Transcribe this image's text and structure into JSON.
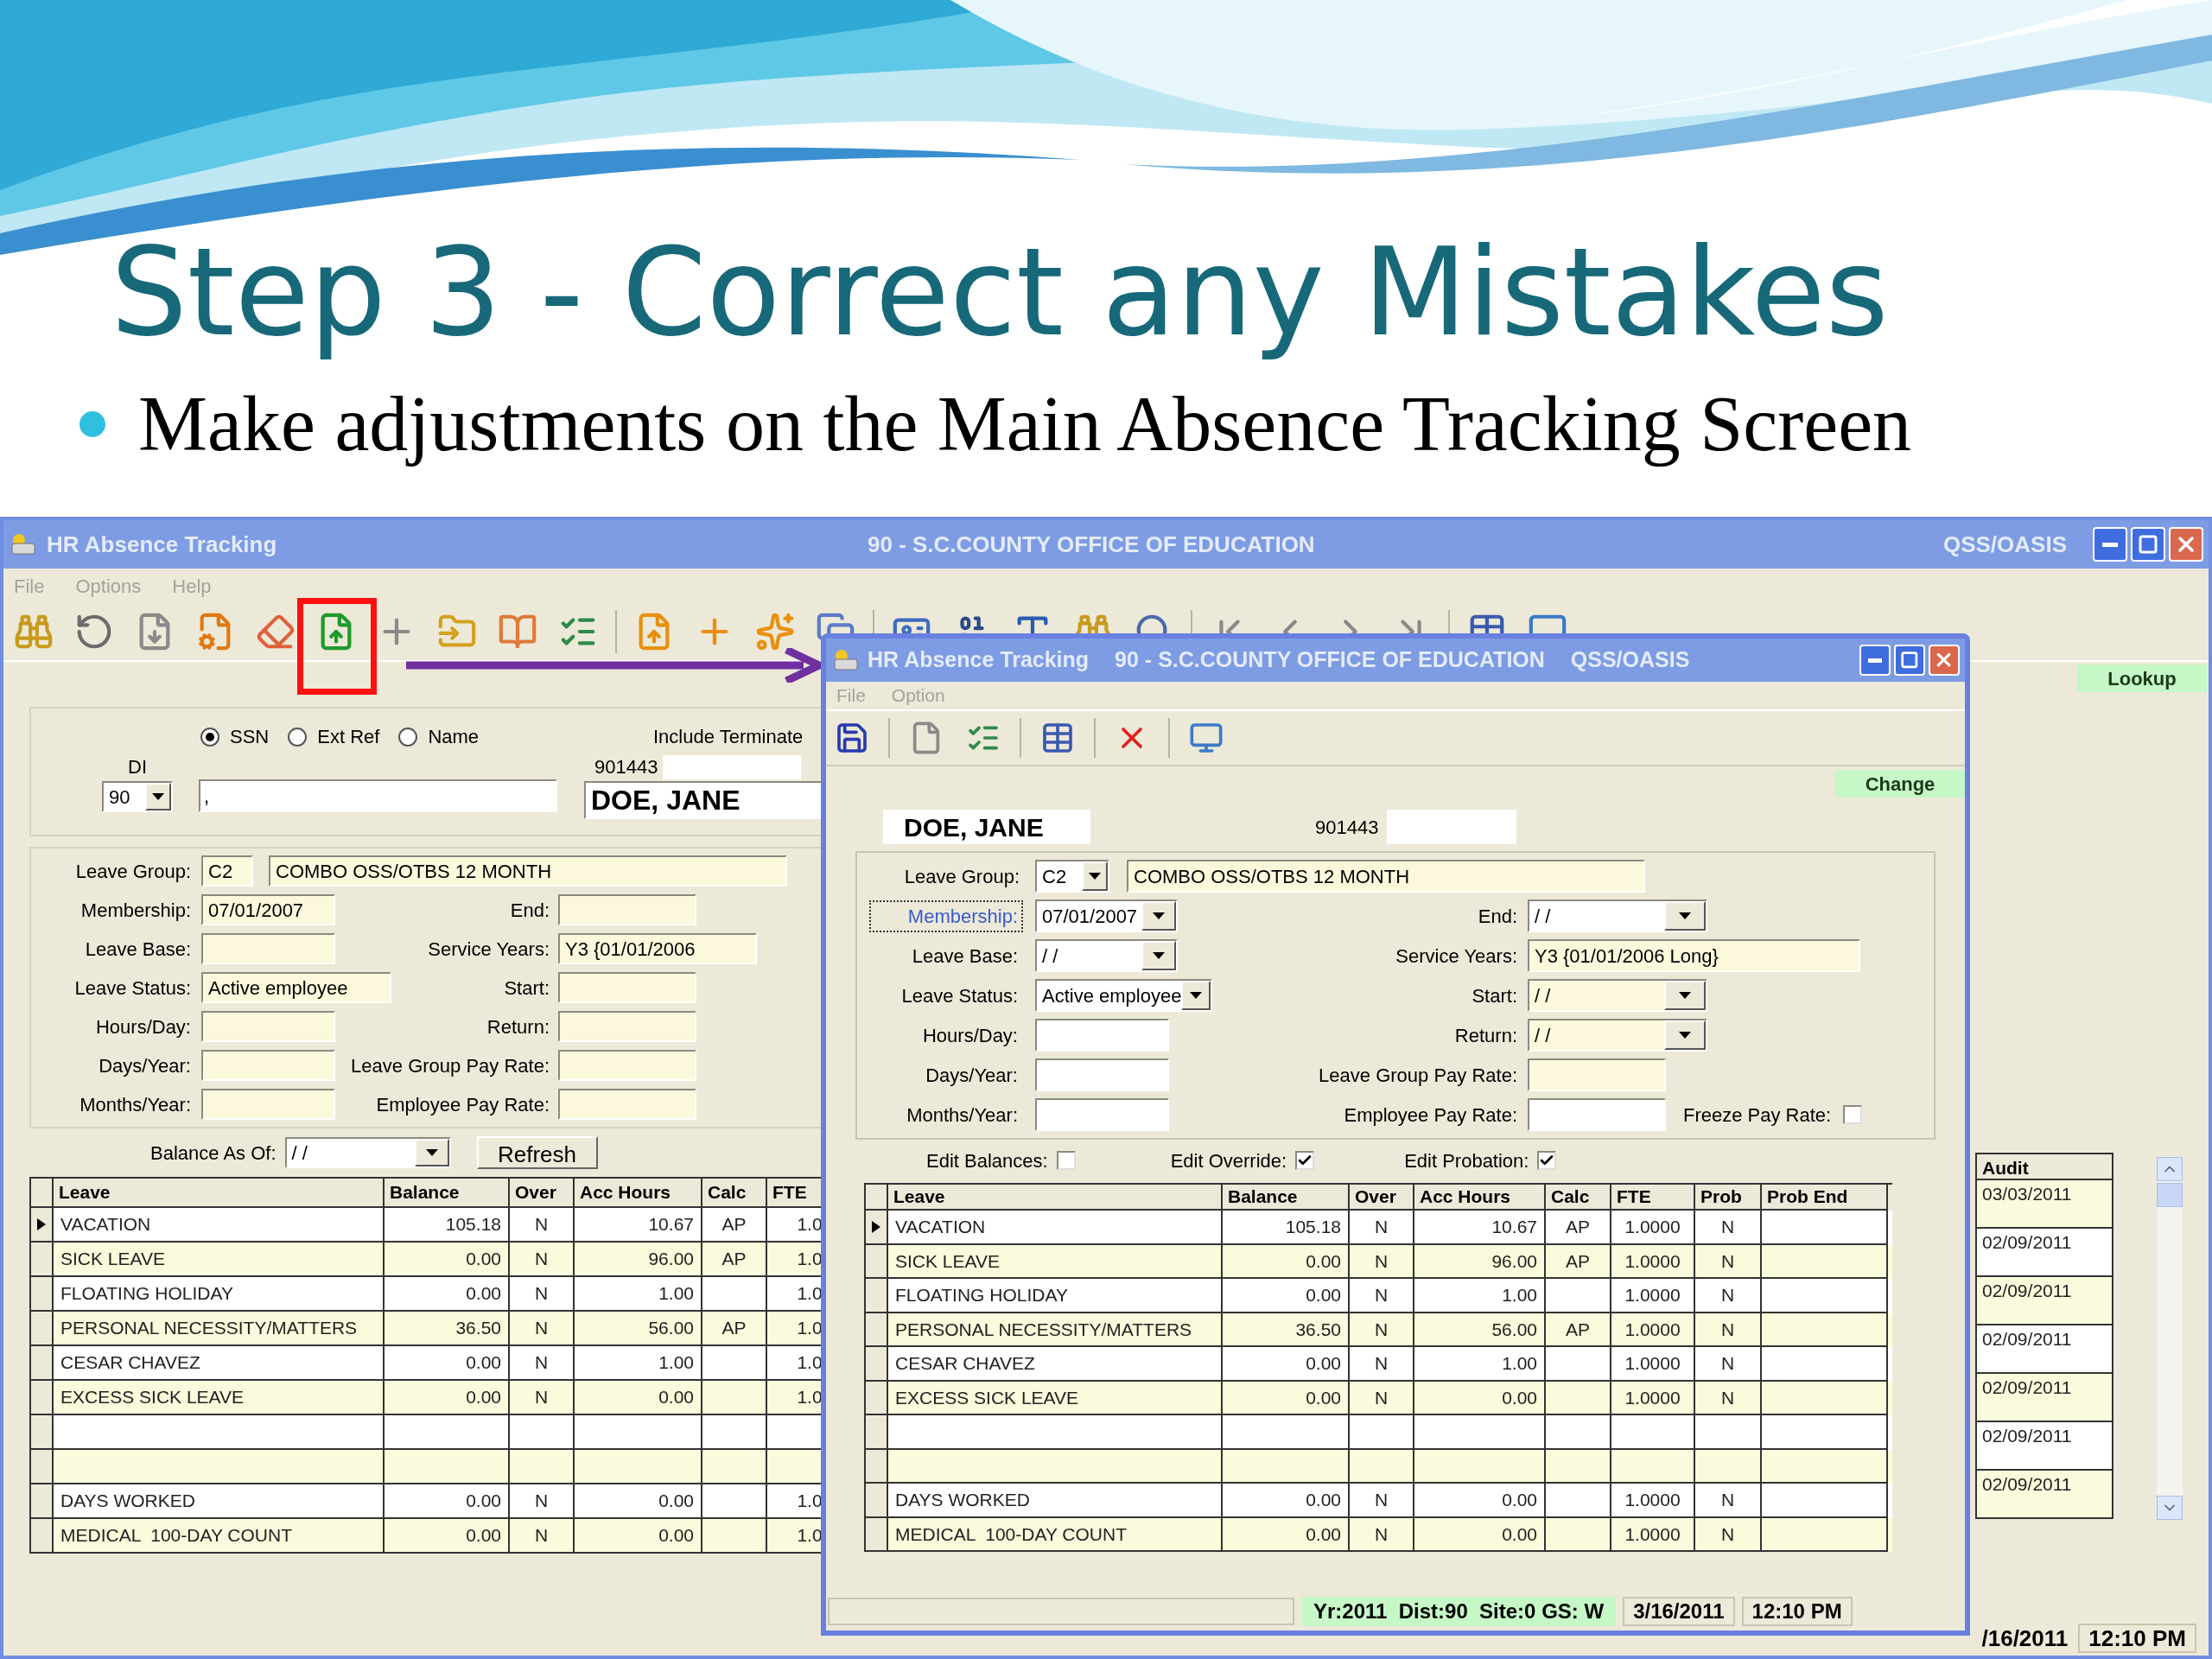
{
  "slide": {
    "title": "Step 3 - Correct any Mistakes",
    "bullet": "Make adjustments on the Main Absence Tracking Screen"
  },
  "main_window": {
    "title": "HR Absence Tracking",
    "district": "90 - S.C.COUNTY OFFICE OF EDUCATION",
    "product": "QSS/OASIS",
    "menu": [
      "File",
      "Options",
      "Help"
    ],
    "toolbar": [
      {
        "kind": "binoculars",
        "highlighted": false
      },
      {
        "kind": "undo",
        "highlighted": false
      },
      {
        "kind": "page-down",
        "highlighted": false
      },
      {
        "kind": "page-gear",
        "highlighted": false
      },
      {
        "kind": "eraser",
        "highlighted": false
      },
      {
        "kind": "page-up",
        "highlighted": true
      },
      {
        "kind": "plus",
        "highlighted": false
      },
      {
        "kind": "folder",
        "highlighted": false
      },
      {
        "kind": "book",
        "highlighted": false
      },
      {
        "kind": "checklist",
        "highlighted": false
      },
      {
        "kind": "separator"
      },
      {
        "kind": "page-up-orange",
        "highlighted": false
      },
      {
        "kind": "plus-orange",
        "highlighted": false
      },
      {
        "kind": "sparkle",
        "highlighted": false
      },
      {
        "kind": "copy",
        "highlighted": false
      },
      {
        "kind": "separator"
      },
      {
        "kind": "card",
        "highlighted": false
      },
      {
        "kind": "binary",
        "highlighted": false
      },
      {
        "kind": "text",
        "highlighted": false
      },
      {
        "kind": "binoculars",
        "highlighted": false
      },
      {
        "kind": "search",
        "highlighted": false
      },
      {
        "kind": "separator"
      },
      {
        "kind": "first",
        "highlighted": false
      },
      {
        "kind": "prev",
        "highlighted": false
      },
      {
        "kind": "next",
        "highlighted": false
      },
      {
        "kind": "last",
        "highlighted": false
      },
      {
        "kind": "separator"
      },
      {
        "kind": "grid",
        "highlighted": false
      },
      {
        "kind": "computer",
        "highlighted": false
      }
    ],
    "mode": "Lookup",
    "search": {
      "options": [
        {
          "label": "SSN",
          "selected": true
        },
        {
          "label": "Ext Ref",
          "selected": false
        },
        {
          "label": "Name",
          "selected": false
        }
      ],
      "di_label": "DI",
      "di_value": "90",
      "search_value": ",",
      "include_label": "Include Terminate",
      "id": "901443",
      "name": "DOE, JANE"
    },
    "leave_group": {
      "label": "Leave Group:",
      "code": "C2",
      "name": "COMBO OSS/OTBS 12 MONTH"
    },
    "rows": [
      {
        "left": {
          "label": "Membership:",
          "value": "07/01/2007"
        },
        "right": {
          "label": "End:"
        }
      },
      {
        "left": {
          "label": "Leave Base:"
        },
        "right": {
          "label": "Service Years:",
          "value": "Y3 {01/01/2006"
        }
      },
      {
        "left": {
          "label": "Leave Status:",
          "value": "Active employee"
        },
        "right": {
          "label": "Start:"
        }
      },
      {
        "left": {
          "label": "Hours/Day:"
        },
        "right": {
          "label": "Return:"
        }
      },
      {
        "left": {
          "label": "Days/Year:"
        },
        "right": {
          "label": "Leave Group Pay Rate:"
        }
      },
      {
        "left": {
          "label": "Months/Year:"
        },
        "right": {
          "label": "Employee Pay Rate:"
        }
      }
    ],
    "balance_as_of": {
      "label": "Balance As Of:",
      "value": "/ /"
    },
    "refresh_button": "Refresh",
    "table": {
      "columns": [
        "Leave",
        "Balance",
        "Over",
        "Acc Hours",
        "Calc",
        "FTE"
      ],
      "rows": [
        {
          "selected": true,
          "leave": "VACATION",
          "balance": "105.18",
          "over": "N",
          "acc_hours": "10.67",
          "calc": "AP",
          "fte": "1.0"
        },
        {
          "selected": false,
          "leave": "SICK LEAVE",
          "balance": "0.00",
          "over": "N",
          "acc_hours": "96.00",
          "calc": "AP",
          "fte": "1.0"
        },
        {
          "selected": false,
          "leave": "FLOATING HOLIDAY",
          "balance": "0.00",
          "over": "N",
          "acc_hours": "1.00",
          "fte": "1.0"
        },
        {
          "selected": false,
          "leave": "PERSONAL NECESSITY/MATTERS",
          "balance": "36.50",
          "over": "N",
          "acc_hours": "56.00",
          "calc": "AP",
          "fte": "1.0"
        },
        {
          "selected": false,
          "leave": "CESAR CHAVEZ",
          "balance": "0.00",
          "over": "N",
          "acc_hours": "1.00",
          "fte": "1.0"
        },
        {
          "selected": false,
          "leave": "EXCESS SICK LEAVE",
          "balance": "0.00",
          "over": "N",
          "acc_hours": "0.00",
          "fte": "1.0"
        },
        {
          "selected": false
        },
        {
          "selected": false
        },
        {
          "selected": false,
          "leave": "DAYS WORKED",
          "balance": "0.00",
          "over": "N",
          "acc_hours": "0.00",
          "fte": "1.0"
        },
        {
          "selected": false,
          "leave": "MEDICAL  100-DAY COUNT",
          "balance": "0.00",
          "over": "N",
          "acc_hours": "0.00",
          "fte": "1.0"
        }
      ]
    },
    "audit": {
      "label": "Audit",
      "values": [
        "03/03/2011",
        "02/09/2011",
        "02/09/2011",
        "02/09/2011",
        "02/09/2011",
        "02/09/2011",
        "02/09/2011"
      ]
    },
    "status": {
      "date": "/16/2011",
      "time": "12:10 PM"
    }
  },
  "dialog": {
    "title": "HR Absence Tracking",
    "district": "90 - S.C.COUNTY OFFICE OF EDUCATION",
    "product": "QSS/OASIS",
    "menu": [
      "File",
      "Option"
    ],
    "toolbar": [
      {
        "kind": "save"
      },
      {
        "kind": "separator"
      },
      {
        "kind": "page"
      },
      {
        "kind": "checklist"
      },
      {
        "kind": "separator"
      },
      {
        "kind": "grid"
      },
      {
        "kind": "separator"
      },
      {
        "kind": "delete"
      },
      {
        "kind": "separator"
      },
      {
        "kind": "computer"
      }
    ],
    "mode": "Change",
    "name": "DOE, JANE",
    "id": "901443",
    "leave_group": {
      "label": "Leave Group:",
      "code": "C2",
      "name": "COMBO OSS/OTBS 12 MONTH"
    },
    "rows": [
      {
        "left": {
          "label": "Membership:",
          "value": "07/01/2007",
          "kind": "dropdown",
          "readonly": false,
          "focused": true
        },
        "right": {
          "label": "End:",
          "value": "/ /",
          "kind": "dropdown",
          "readonly": false,
          "focused": false
        }
      },
      {
        "left": {
          "label": "Leave Base:",
          "value": "/ /",
          "kind": "dropdown",
          "readonly": false,
          "focused": false
        },
        "right": {
          "label": "Service Years:",
          "value": "Y3 {01/01/2006 Long}",
          "kind": "text",
          "readonly": true,
          "focused": false
        }
      },
      {
        "left": {
          "label": "Leave Status:",
          "value": "Active employee",
          "kind": "dropdown",
          "readonly": false,
          "focused": false
        },
        "right": {
          "label": "Start:",
          "value": "/ /",
          "kind": "dropdown",
          "readonly": true,
          "focused": false
        }
      },
      {
        "left": {
          "label": "Hours/Day:",
          "kind": "text",
          "readonly": false,
          "focused": false
        },
        "right": {
          "label": "Return:",
          "value": "/ /",
          "kind": "dropdown",
          "readonly": true,
          "focused": false
        }
      },
      {
        "left": {
          "label": "Days/Year:",
          "kind": "text",
          "readonly": false,
          "focused": false
        },
        "right": {
          "label": "Leave Group Pay Rate:",
          "kind": "text",
          "readonly": true,
          "focused": false
        }
      },
      {
        "left": {
          "label": "Months/Year:",
          "kind": "text",
          "readonly": false,
          "focused": false
        },
        "right": {
          "label": "Employee Pay Rate:",
          "kind": "text",
          "readonly": false,
          "focused": false
        },
        "extra": {
          "label": "Freeze Pay Rate:",
          "checked": false
        }
      }
    ],
    "edit_options": [
      {
        "label": "Edit Balances:",
        "checked": false
      },
      {
        "label": "Edit Override:",
        "checked": true
      },
      {
        "label": "Edit Probation:",
        "checked": true
      }
    ],
    "table": {
      "columns": [
        "Leave",
        "Balance",
        "Over",
        "Acc Hours",
        "Calc",
        "FTE",
        "Prob",
        "Prob End"
      ],
      "rows": [
        {
          "selected": true,
          "leave": "VACATION",
          "balance": "105.18",
          "over": "N",
          "acc_hours": "10.67",
          "calc": "AP",
          "fte": "1.0000",
          "prob": "N"
        },
        {
          "selected": false,
          "leave": "SICK LEAVE",
          "balance": "0.00",
          "over": "N",
          "acc_hours": "96.00",
          "calc": "AP",
          "fte": "1.0000",
          "prob": "N"
        },
        {
          "selected": false,
          "leave": "FLOATING HOLIDAY",
          "balance": "0.00",
          "over": "N",
          "acc_hours": "1.00",
          "fte": "1.0000",
          "prob": "N"
        },
        {
          "selected": false,
          "leave": "PERSONAL NECESSITY/MATTERS",
          "balance": "36.50",
          "over": "N",
          "acc_hours": "56.00",
          "calc": "AP",
          "fte": "1.0000",
          "prob": "N"
        },
        {
          "selected": false,
          "leave": "CESAR CHAVEZ",
          "balance": "0.00",
          "over": "N",
          "acc_hours": "1.00",
          "fte": "1.0000",
          "prob": "N"
        },
        {
          "selected": false,
          "leave": "EXCESS SICK LEAVE",
          "balance": "0.00",
          "over": "N",
          "acc_hours": "0.00",
          "fte": "1.0000",
          "prob": "N"
        },
        {
          "selected": false
        },
        {
          "selected": false
        },
        {
          "selected": false,
          "leave": "DAYS WORKED",
          "balance": "0.00",
          "over": "N",
          "acc_hours": "0.00",
          "fte": "1.0000",
          "prob": "N"
        },
        {
          "selected": false,
          "leave": "MEDICAL  100-DAY COUNT",
          "balance": "0.00",
          "over": "N",
          "acc_hours": "0.00",
          "fte": "1.0000",
          "prob": "N"
        }
      ]
    },
    "status": {
      "info": "Yr:2011  Dist:90  Site:0 GS: W",
      "date": "3/16/2011",
      "time": "12:10 PM"
    }
  }
}
